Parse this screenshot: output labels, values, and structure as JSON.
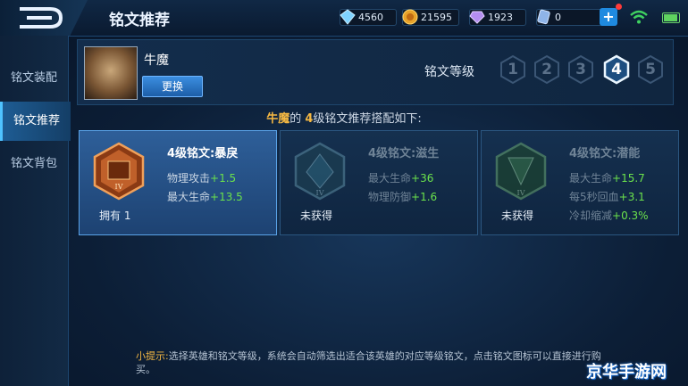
{
  "header": {
    "title": "铭文推荐",
    "resources": [
      {
        "icon": "diamond-icon",
        "value": "4560"
      },
      {
        "icon": "gold-coin-icon",
        "value": "21595"
      },
      {
        "icon": "gem-icon",
        "value": "1923"
      },
      {
        "icon": "voucher-icon",
        "value": "0"
      }
    ]
  },
  "sidebar": {
    "items": [
      {
        "label": "铭文装配",
        "active": false
      },
      {
        "label": "铭文推荐",
        "active": true
      },
      {
        "label": "铭文背包",
        "active": false
      }
    ]
  },
  "hero": {
    "name": "牛魔",
    "switch_label": "更换",
    "level_label": "铭文等级",
    "levels": [
      "1",
      "2",
      "3",
      "4",
      "5"
    ],
    "selected_level": "4"
  },
  "headline": {
    "hero": "牛魔",
    "mid": "的 ",
    "level": "4",
    "rest": "级铭文推荐搭配如下:"
  },
  "cards": [
    {
      "name": "4级铭文:暴戾",
      "stats": [
        {
          "k": "物理攻击",
          "v": "+1.5"
        },
        {
          "k": "最大生命",
          "v": "+13.5"
        }
      ],
      "own_label": "拥有",
      "own_count": "1",
      "status": "",
      "color": "#d0662a"
    },
    {
      "name": "4级铭文:滋生",
      "stats": [
        {
          "k": "最大生命",
          "v": "+36"
        },
        {
          "k": "物理防御",
          "v": "+1.6"
        }
      ],
      "own_label": "",
      "own_count": "",
      "status": "未获得",
      "color": "#3f8fb0"
    },
    {
      "name": "4级铭文:潜能",
      "stats": [
        {
          "k": "最大生命",
          "v": "+15.7"
        },
        {
          "k": "每5秒回血",
          "v": "+3.1"
        },
        {
          "k": "冷却缩减",
          "v": "+0.3%"
        }
      ],
      "own_label": "",
      "own_count": "",
      "status": "未获得",
      "color": "#4e9a55"
    }
  ],
  "tip": {
    "key": "小提示:",
    "text": "选择英雄和铭文等级，系统会自动筛选出适合该英雄的对应等级铭文，点击铭文图标可以直接进行购买。"
  },
  "watermark": "京华手游网"
}
